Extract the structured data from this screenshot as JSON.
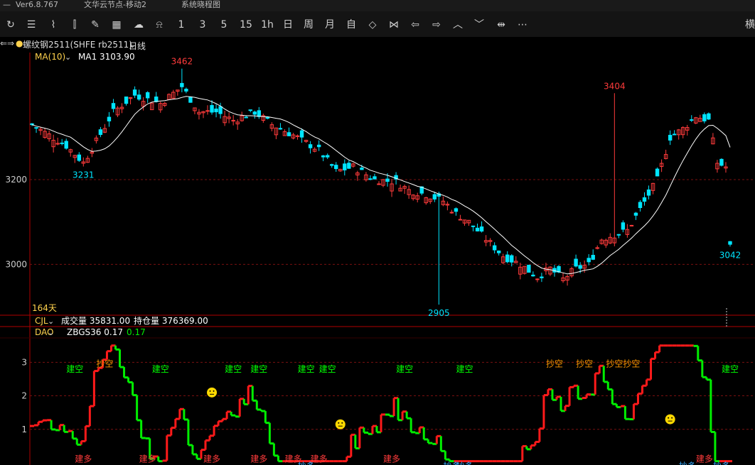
{
  "titlebar": {
    "menu": "—",
    "version": "Ver6.8.767",
    "app": "文华云节点-移动2",
    "sys": "系统晓程图"
  },
  "toolbar": {
    "icons": [
      "refresh-icon",
      "list-icon",
      "line-chart-icon",
      "candle-icon",
      "draw-icon",
      "table-icon",
      "cloud-icon",
      "bell-icon"
    ],
    "periods": [
      "1",
      "3",
      "5",
      "15",
      "1h",
      "日",
      "周",
      "月",
      "自"
    ],
    "nav_icons": [
      "expand-icon",
      "shrink-icon",
      "left-arrow-icon",
      "right-arrow-icon",
      "up-icon",
      "down-icon",
      "move-icon",
      "more-icon"
    ],
    "right_char": "横"
  },
  "infobar": {
    "arrows": "⇐⇒",
    "symbol": "螺纹钢2511(SHFE rb2511)",
    "period": "日线"
  },
  "main_panel": {
    "ma_label": "MA(10)",
    "ma_value": "MA1 3103.90",
    "days_label": "164天",
    "y_ticks": [
      {
        "v": 3200,
        "t": "3200"
      },
      {
        "v": 3000,
        "t": "3000"
      }
    ],
    "annotations": [
      {
        "t": "3462",
        "i": 35,
        "v": 3462,
        "pos": "above",
        "c": "#ff3b3b"
      },
      {
        "t": "3231",
        "i": 12,
        "v": 3231,
        "pos": "below",
        "c": "#00e5ff"
      },
      {
        "t": "3404",
        "i": 136,
        "v": 3404,
        "pos": "above",
        "c": "#ff3b3b"
      },
      {
        "t": "2905",
        "i": 95,
        "v": 2905,
        "pos": "below",
        "c": "#00e5ff"
      },
      {
        "t": "3042",
        "i": 163,
        "v": 3042,
        "pos": "below",
        "c": "#00e5ff"
      }
    ]
  },
  "volume_bar": {
    "name": "CJL",
    "volume": "成交量 35831.00",
    "oi": "持仓量 376369.00"
  },
  "dao_panel": {
    "name": "DAO",
    "param": "ZBGS36 0.17",
    "value": "0.17",
    "y_ticks": [
      {
        "v": 3,
        "t": "3"
      },
      {
        "v": 2,
        "t": "2"
      },
      {
        "v": 1,
        "t": "1"
      }
    ],
    "signals": [
      {
        "t": "建空",
        "i": 10,
        "y": 2.8,
        "c": "#00ff00"
      },
      {
        "t": "抄空",
        "i": 17,
        "y": 2.95,
        "c": "#ff9900"
      },
      {
        "t": "建空",
        "i": 30,
        "y": 2.8,
        "c": "#00ff00"
      },
      {
        "t": "建空",
        "i": 47,
        "y": 2.8,
        "c": "#00ff00"
      },
      {
        "t": "建空",
        "i": 53,
        "y": 2.8,
        "c": "#00ff00"
      },
      {
        "t": "建空",
        "i": 64,
        "y": 2.8,
        "c": "#00ff00"
      },
      {
        "t": "建空",
        "i": 69,
        "y": 2.8,
        "c": "#00ff00"
      },
      {
        "t": "建空",
        "i": 87,
        "y": 2.8,
        "c": "#00ff00"
      },
      {
        "t": "建空",
        "i": 101,
        "y": 2.8,
        "c": "#00ff00"
      },
      {
        "t": "抄空",
        "i": 122,
        "y": 2.95,
        "c": "#ff9900"
      },
      {
        "t": "抄空",
        "i": 129,
        "y": 2.95,
        "c": "#ff9900"
      },
      {
        "t": "抄空",
        "i": 136,
        "y": 2.95,
        "c": "#ff9900"
      },
      {
        "t": "抄空",
        "i": 140,
        "y": 2.95,
        "c": "#ff9900"
      },
      {
        "t": "建空",
        "i": 163,
        "y": 2.8,
        "c": "#00ff00"
      },
      {
        "t": "建多",
        "i": 12,
        "y": 0.12,
        "c": "#ff3b3b"
      },
      {
        "t": "建多",
        "i": 27,
        "y": 0.12,
        "c": "#ff3b3b"
      },
      {
        "t": "建多",
        "i": 42,
        "y": 0.12,
        "c": "#ff3b3b"
      },
      {
        "t": "建多",
        "i": 53,
        "y": 0.12,
        "c": "#ff3b3b"
      },
      {
        "t": "建多",
        "i": 61,
        "y": 0.12,
        "c": "#ff3b3b"
      },
      {
        "t": "建多",
        "i": 67,
        "y": 0.12,
        "c": "#ff3b3b"
      },
      {
        "t": "建多",
        "i": 84,
        "y": 0.12,
        "c": "#ff3b3b"
      },
      {
        "t": "抄多",
        "i": 64,
        "y": -0.1,
        "c": "#33aaff"
      },
      {
        "t": "抄多",
        "i": 98,
        "y": -0.1,
        "c": "#33aaff"
      },
      {
        "t": "抄多",
        "i": 101,
        "y": -0.1,
        "c": "#33aaff"
      },
      {
        "t": "建多",
        "i": 157,
        "y": 0.12,
        "c": "#ff3b3b"
      },
      {
        "t": "抄多",
        "i": 153,
        "y": -0.1,
        "c": "#33aaff"
      },
      {
        "t": "抄多",
        "i": 161,
        "y": -0.1,
        "c": "#33aaff"
      }
    ],
    "smileys": [
      {
        "i": 42,
        "y": 2.1
      },
      {
        "i": 72,
        "y": 1.15
      },
      {
        "i": 149,
        "y": 1.3
      }
    ]
  },
  "colors": {
    "up": "#ff3b3b",
    "down": "#00e5ff",
    "ma": "#ffffff",
    "grid": "#7a1010",
    "axis": "#b00000",
    "dao_up": "#ff1a1a",
    "dao_down": "#00ee00",
    "label_yellow": "#ffd24d"
  },
  "chart_data": {
    "type": "candlestick",
    "symbol": "螺纹钢2511(SHFE rb2511)",
    "period": "日线",
    "bars": 164,
    "close_keypoints": [
      [
        0,
        3330
      ],
      [
        8,
        3280
      ],
      [
        12,
        3240
      ],
      [
        15,
        3290
      ],
      [
        19,
        3360
      ],
      [
        24,
        3400
      ],
      [
        30,
        3380
      ],
      [
        35,
        3420
      ],
      [
        39,
        3360
      ],
      [
        43,
        3360
      ],
      [
        47,
        3340
      ],
      [
        52,
        3360
      ],
      [
        56,
        3330
      ],
      [
        61,
        3305
      ],
      [
        67,
        3270
      ],
      [
        71,
        3220
      ],
      [
        75,
        3230
      ],
      [
        80,
        3200
      ],
      [
        85,
        3195
      ],
      [
        88,
        3175
      ],
      [
        92,
        3165
      ],
      [
        96,
        3150
      ],
      [
        99,
        3120
      ],
      [
        102,
        3100
      ],
      [
        106,
        3060
      ],
      [
        110,
        3020
      ],
      [
        114,
        3000
      ],
      [
        118,
        2970
      ],
      [
        121,
        2990
      ],
      [
        124,
        2965
      ],
      [
        127,
        2990
      ],
      [
        130,
        3000
      ],
      [
        133,
        3060
      ],
      [
        136,
        3070
      ],
      [
        139,
        3080
      ],
      [
        142,
        3130
      ],
      [
        146,
        3200
      ],
      [
        149,
        3300
      ],
      [
        152,
        3320
      ],
      [
        155,
        3350
      ],
      [
        158,
        3340
      ],
      [
        160,
        3240
      ],
      [
        162,
        3230
      ],
      [
        163,
        3042
      ]
    ],
    "ma10_last": 3103.9,
    "high_mark": 3462,
    "low_mark": 2905,
    "high2_mark": 3404,
    "low_mark2": 3231,
    "last_mark": 3042,
    "y_range": [
      2880,
      3500
    ],
    "dao_range": [
      0,
      3.6
    ]
  }
}
